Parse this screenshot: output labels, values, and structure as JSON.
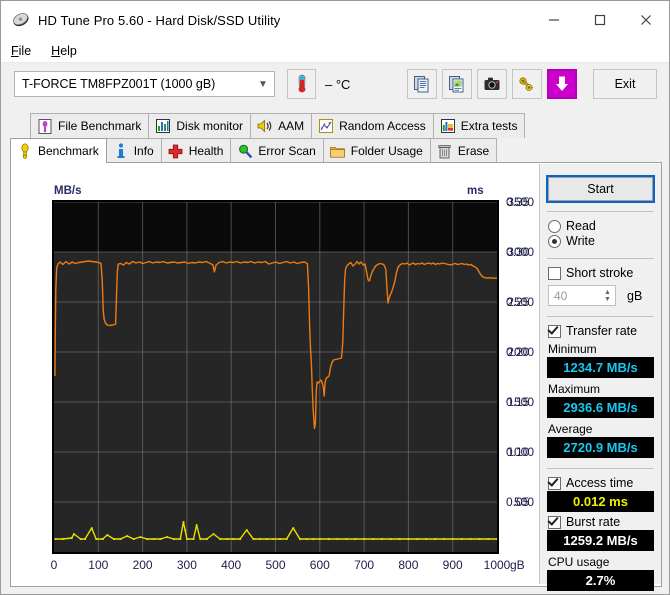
{
  "window": {
    "title": "HD Tune Pro 5.60 - Hard Disk/SSD Utility",
    "icon": "hdtune-logo-icon",
    "minimize": "–",
    "maximize": "□",
    "close": "✕"
  },
  "menu": {
    "items": [
      {
        "label": "File",
        "accel": "F"
      },
      {
        "label": "Help",
        "accel": "H"
      }
    ]
  },
  "toolbar": {
    "drive": "T-FORCE TM8FPZ001T (1000 gB)",
    "temperature": "– °C",
    "buttons": [
      {
        "name": "copy-button",
        "icon": "copy-icon"
      },
      {
        "name": "copy-image-button",
        "icon": "copy-image-icon"
      },
      {
        "name": "screenshot-button",
        "icon": "camera-icon"
      },
      {
        "name": "options-button",
        "icon": "keys-icon"
      },
      {
        "name": "save-button",
        "icon": "download-arrow-icon"
      }
    ],
    "exit_label": "Exit"
  },
  "tabs": {
    "top_row": [
      {
        "label": "File Benchmark",
        "icon": "file-benchmark-icon",
        "active": false
      },
      {
        "label": "Disk monitor",
        "icon": "disk-monitor-icon",
        "active": false
      },
      {
        "label": "AAM",
        "icon": "speaker-icon",
        "active": false
      },
      {
        "label": "Random Access",
        "icon": "random-access-icon",
        "active": false
      },
      {
        "label": "Extra tests",
        "icon": "extra-tests-icon",
        "active": false
      }
    ],
    "bottom_row": [
      {
        "label": "Benchmark",
        "icon": "benchmark-bulb-icon",
        "active": true
      },
      {
        "label": "Info",
        "icon": "info-icon",
        "active": false
      },
      {
        "label": "Health",
        "icon": "health-cross-icon",
        "active": false
      },
      {
        "label": "Error Scan",
        "icon": "magnifier-icon",
        "active": false
      },
      {
        "label": "Folder Usage",
        "icon": "folder-icon",
        "active": false
      },
      {
        "label": "Erase",
        "icon": "trash-icon",
        "active": false
      }
    ]
  },
  "sidebar": {
    "start_label": "Start",
    "mode": {
      "read_label": "Read",
      "write_label": "Write",
      "selected": "Write"
    },
    "short_stroke": {
      "label": "Short stroke",
      "checked": false,
      "value": "40",
      "unit": "gB"
    },
    "transfer_rate": {
      "label": "Transfer rate",
      "checked": true
    },
    "minimum": {
      "label": "Minimum",
      "value": "1234.7 MB/s"
    },
    "maximum": {
      "label": "Maximum",
      "value": "2936.6 MB/s"
    },
    "average": {
      "label": "Average",
      "value": "2720.9 MB/s"
    },
    "access_time": {
      "label": "Access time",
      "checked": true,
      "value": "0.012 ms"
    },
    "burst_rate": {
      "label": "Burst rate",
      "checked": true,
      "value": "1259.2 MB/s"
    },
    "cpu_usage": {
      "label": "CPU usage",
      "value": "2.7%"
    }
  },
  "chart_data": {
    "type": "line",
    "title": "",
    "ylabel": "MB/s",
    "ylabel_right": "ms",
    "xlabel": "gB",
    "xlim": [
      0,
      1000
    ],
    "ylim": [
      0,
      3500
    ],
    "ylim_right": [
      0,
      0.35
    ],
    "grid": true,
    "yticks": [
      500,
      1000,
      1500,
      2000,
      2500,
      3000,
      3500
    ],
    "yticks_right": [
      0.05,
      0.1,
      0.15,
      0.2,
      0.25,
      0.3,
      0.35
    ],
    "xticks": [
      0,
      100,
      200,
      300,
      400,
      500,
      600,
      700,
      800,
      900,
      1000
    ],
    "xtick_labels": [
      "0",
      "100",
      "200",
      "300",
      "400",
      "500",
      "600",
      "700",
      "800",
      "900",
      "1000"
    ],
    "colors": {
      "transfer_rate": "#ee7b10",
      "access_time": "#e8e000",
      "plot_bg": "#0a0a0a",
      "grid": "#808080"
    },
    "series": [
      {
        "name": "Transfer rate",
        "axis": "left",
        "color": "#ee7b10",
        "points": [
          [
            2,
            1760
          ],
          [
            3,
            2200
          ],
          [
            4,
            2620
          ],
          [
            6,
            2840
          ],
          [
            9,
            2880
          ],
          [
            14,
            2900
          ],
          [
            20,
            2875
          ],
          [
            27,
            2905
          ],
          [
            34,
            2880
          ],
          [
            41,
            2900
          ],
          [
            48,
            2885
          ],
          [
            56,
            2895
          ],
          [
            63,
            2900
          ],
          [
            70,
            2905
          ],
          [
            78,
            2910
          ],
          [
            86,
            2905
          ],
          [
            94,
            2900
          ],
          [
            101,
            2895
          ],
          [
            106,
            2885
          ],
          [
            109,
            2700
          ],
          [
            111,
            2420
          ],
          [
            113,
            2330
          ],
          [
            116,
            2290
          ],
          [
            120,
            2270
          ],
          [
            126,
            2265
          ],
          [
            132,
            2270
          ],
          [
            137,
            2275
          ],
          [
            139,
            2280
          ],
          [
            141,
            2560
          ],
          [
            143,
            2800
          ],
          [
            145,
            2880
          ],
          [
            150,
            2885
          ],
          [
            157,
            2870
          ],
          [
            163,
            2895
          ],
          [
            170,
            2880
          ],
          [
            178,
            2905
          ],
          [
            185,
            2890
          ],
          [
            193,
            2900
          ],
          [
            200,
            2885
          ],
          [
            208,
            2895
          ],
          [
            215,
            2905
          ],
          [
            223,
            2890
          ],
          [
            231,
            2900
          ],
          [
            239,
            2895
          ],
          [
            247,
            2905
          ],
          [
            255,
            2890
          ],
          [
            263,
            2895
          ],
          [
            271,
            2900
          ],
          [
            279,
            2890
          ],
          [
            287,
            2895
          ],
          [
            295,
            2900
          ],
          [
            303,
            2885
          ],
          [
            311,
            2895
          ],
          [
            319,
            2890
          ],
          [
            327,
            2900
          ],
          [
            335,
            2895
          ],
          [
            343,
            2905
          ],
          [
            351,
            2890
          ],
          [
            359,
            2870
          ],
          [
            362,
            2800
          ],
          [
            366,
            2870
          ],
          [
            373,
            2895
          ],
          [
            381,
            2905
          ],
          [
            389,
            2890
          ],
          [
            397,
            2900
          ],
          [
            405,
            2895
          ],
          [
            413,
            2905
          ],
          [
            421,
            2890
          ],
          [
            429,
            2900
          ],
          [
            437,
            2895
          ],
          [
            445,
            2905
          ],
          [
            453,
            2890
          ],
          [
            461,
            2900
          ],
          [
            469,
            2895
          ],
          [
            477,
            2905
          ],
          [
            485,
            2880
          ],
          [
            493,
            2890
          ],
          [
            501,
            2900
          ],
          [
            509,
            2885
          ],
          [
            517,
            2895
          ],
          [
            525,
            2905
          ],
          [
            533,
            2890
          ],
          [
            541,
            2900
          ],
          [
            549,
            2885
          ],
          [
            557,
            2895
          ],
          [
            565,
            2900
          ],
          [
            572,
            2885
          ],
          [
            575,
            2620
          ],
          [
            577,
            2260
          ],
          [
            579,
            2040
          ],
          [
            581,
            1880
          ],
          [
            583,
            1620
          ],
          [
            585,
            1420
          ],
          [
            587,
            1300
          ],
          [
            588,
            1235
          ],
          [
            590,
            1290
          ],
          [
            592,
            1620
          ],
          [
            594,
            1700
          ],
          [
            596,
            1690
          ],
          [
            599,
            1700
          ],
          [
            602,
            1720
          ],
          [
            605,
            1700
          ],
          [
            608,
            1650
          ],
          [
            610,
            1560
          ],
          [
            612,
            1700
          ],
          [
            615,
            1740
          ],
          [
            618,
            1750
          ],
          [
            621,
            1760
          ],
          [
            624,
            1840
          ],
          [
            627,
            1890
          ],
          [
            631,
            1920
          ],
          [
            635,
            1925
          ],
          [
            640,
            1930
          ],
          [
            645,
            1935
          ],
          [
            649,
            1940
          ],
          [
            652,
            2100
          ],
          [
            654,
            2420
          ],
          [
            656,
            2700
          ],
          [
            658,
            2830
          ],
          [
            661,
            2860
          ],
          [
            665,
            2880
          ],
          [
            670,
            2895
          ],
          [
            675,
            2860
          ],
          [
            679,
            2875
          ],
          [
            684,
            2905
          ],
          [
            689,
            2880
          ],
          [
            693,
            2900
          ],
          [
            698,
            2870
          ],
          [
            702,
            2880
          ],
          [
            706,
            2790
          ],
          [
            709,
            2720
          ],
          [
            712,
            2710
          ],
          [
            715,
            2760
          ],
          [
            718,
            2800
          ],
          [
            722,
            2830
          ],
          [
            726,
            2860
          ],
          [
            731,
            2875
          ],
          [
            736,
            2885
          ],
          [
            741,
            2880
          ],
          [
            745,
            2870
          ],
          [
            749,
            2830
          ],
          [
            752,
            2620
          ],
          [
            754,
            2490
          ],
          [
            756,
            2530
          ],
          [
            759,
            2570
          ],
          [
            762,
            2600
          ],
          [
            765,
            2640
          ],
          [
            769,
            2700
          ],
          [
            773,
            2790
          ],
          [
            777,
            2850
          ],
          [
            782,
            2875
          ],
          [
            787,
            2885
          ],
          [
            792,
            2880
          ],
          [
            797,
            2890
          ],
          [
            802,
            2870
          ],
          [
            806,
            2880
          ],
          [
            811,
            2890
          ],
          [
            816,
            2875
          ],
          [
            821,
            2885
          ],
          [
            826,
            2880
          ],
          [
            831,
            2890
          ],
          [
            836,
            2875
          ],
          [
            841,
            2885
          ],
          [
            846,
            2890
          ],
          [
            851,
            2880
          ],
          [
            856,
            2890
          ],
          [
            861,
            2875
          ],
          [
            866,
            2885
          ],
          [
            871,
            2880
          ],
          [
            876,
            2890
          ],
          [
            881,
            2885
          ],
          [
            886,
            2880
          ],
          [
            891,
            2875
          ],
          [
            896,
            2870
          ],
          [
            901,
            2880
          ],
          [
            906,
            2885
          ],
          [
            911,
            2875
          ],
          [
            916,
            2880
          ],
          [
            921,
            2885
          ],
          [
            926,
            2875
          ],
          [
            931,
            2880
          ],
          [
            936,
            2870
          ],
          [
            941,
            2875
          ],
          [
            946,
            2860
          ],
          [
            951,
            2850
          ],
          [
            956,
            2830
          ],
          [
            961,
            2790
          ],
          [
            966,
            2760
          ],
          [
            971,
            2745
          ],
          [
            976,
            2740
          ],
          [
            982,
            2742
          ],
          [
            988,
            2740
          ],
          [
            995,
            2738
          ],
          [
            1000,
            2738
          ]
        ]
      },
      {
        "name": "Access time",
        "axis": "right",
        "color": "#e8e000",
        "points": [
          [
            3,
            0.013
          ],
          [
            20,
            0.013
          ],
          [
            40,
            0.014
          ],
          [
            45,
            0.018
          ],
          [
            60,
            0.013
          ],
          [
            70,
            0.013
          ],
          [
            85,
            0.024
          ],
          [
            95,
            0.013
          ],
          [
            110,
            0.013
          ],
          [
            120,
            0.017
          ],
          [
            135,
            0.013
          ],
          [
            150,
            0.013
          ],
          [
            165,
            0.016
          ],
          [
            180,
            0.013
          ],
          [
            195,
            0.015
          ],
          [
            210,
            0.013
          ],
          [
            225,
            0.013
          ],
          [
            240,
            0.013
          ],
          [
            255,
            0.015
          ],
          [
            270,
            0.013
          ],
          [
            285,
            0.013
          ],
          [
            292,
            0.03
          ],
          [
            296,
            0.022
          ],
          [
            300,
            0.013
          ],
          [
            315,
            0.013
          ],
          [
            322,
            0.027
          ],
          [
            330,
            0.013
          ],
          [
            345,
            0.013
          ],
          [
            360,
            0.018
          ],
          [
            375,
            0.013
          ],
          [
            390,
            0.013
          ],
          [
            405,
            0.013
          ],
          [
            420,
            0.013
          ],
          [
            435,
            0.022
          ],
          [
            450,
            0.013
          ],
          [
            465,
            0.013
          ],
          [
            480,
            0.013
          ],
          [
            495,
            0.013
          ],
          [
            510,
            0.013
          ],
          [
            525,
            0.013
          ],
          [
            540,
            0.024
          ],
          [
            555,
            0.013
          ],
          [
            570,
            0.013
          ],
          [
            585,
            0.013
          ],
          [
            600,
            0.013
          ],
          [
            620,
            0.013
          ],
          [
            640,
            0.013
          ],
          [
            660,
            0.013
          ],
          [
            680,
            0.013
          ],
          [
            700,
            0.013
          ],
          [
            720,
            0.013
          ],
          [
            740,
            0.013
          ],
          [
            760,
            0.013
          ],
          [
            780,
            0.013
          ],
          [
            800,
            0.013
          ],
          [
            820,
            0.013
          ],
          [
            840,
            0.013
          ],
          [
            860,
            0.013
          ],
          [
            880,
            0.013
          ],
          [
            900,
            0.013
          ],
          [
            920,
            0.013
          ],
          [
            940,
            0.013
          ],
          [
            960,
            0.013
          ],
          [
            980,
            0.013
          ],
          [
            1000,
            0.013
          ]
        ]
      }
    ]
  }
}
